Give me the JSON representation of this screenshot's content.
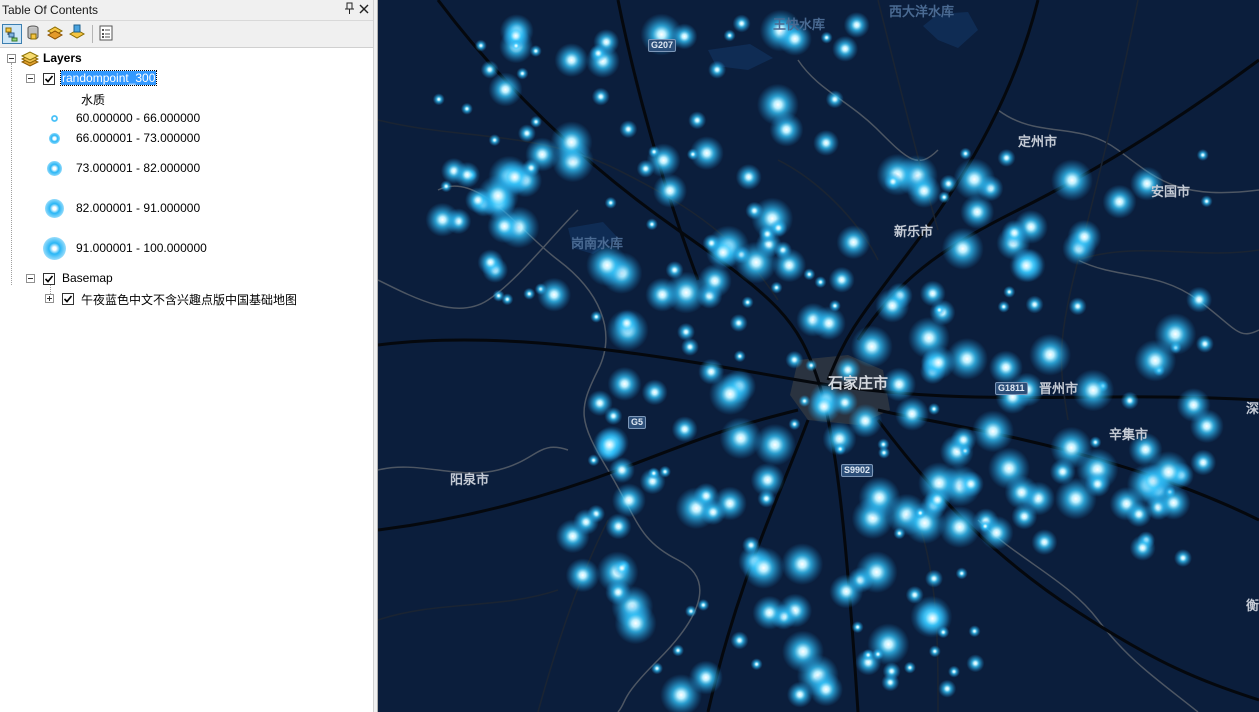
{
  "toc": {
    "title": "Table Of Contents",
    "pin_glyph": "p",
    "close_glyph": "✕",
    "toolbar": [
      {
        "name": "list-by-drawing-order-icon",
        "active": true
      },
      {
        "name": "list-by-source-icon",
        "active": false
      },
      {
        "name": "list-by-visibility-icon",
        "active": false
      },
      {
        "name": "list-by-selection-icon",
        "active": false
      },
      {
        "name": "options-icon",
        "active": false
      }
    ],
    "root": {
      "label": "Layers",
      "expanded": true
    },
    "layer": {
      "label": "randompoint_300",
      "checked": true,
      "selected": true,
      "field": "水质",
      "classes": [
        {
          "label": "60.000000 - 66.000000",
          "size": "smallest"
        },
        {
          "label": "66.000001 - 73.000000",
          "size": "small"
        },
        {
          "label": "73.000001 - 82.000000",
          "size": "medium"
        },
        {
          "label": "82.000001 - 91.000000",
          "size": "large"
        },
        {
          "label": "91.000001 - 100.000000",
          "size": "largest"
        }
      ],
      "symbol_color": "#29b6f6"
    },
    "basemap_group": {
      "label": "Basemap",
      "checked": true,
      "expanded": true
    },
    "basemap_layer": {
      "label": "午夜蓝色中文不含兴趣点版中国基础地图",
      "checked": true,
      "expanded": false
    }
  },
  "map": {
    "background": "#0b1e3c",
    "point_color": "#35c8ff",
    "labels": {
      "wangkuai": "王快水库",
      "xidayang": "西大洋水库",
      "dingzhou": "定州市",
      "anguo": "安国市",
      "xinle": "新乐市",
      "gangnan": "岗南水库",
      "shijiazhuang": "石家庄市",
      "jinzhou": "晋州市",
      "xinji": "辛集市",
      "yangquan": "阳泉市",
      "shen": "深",
      "heng": "衡"
    },
    "shields": {
      "g207": "G207",
      "g5": "G5",
      "g1811": "G1811",
      "s9902": "S9902"
    }
  }
}
